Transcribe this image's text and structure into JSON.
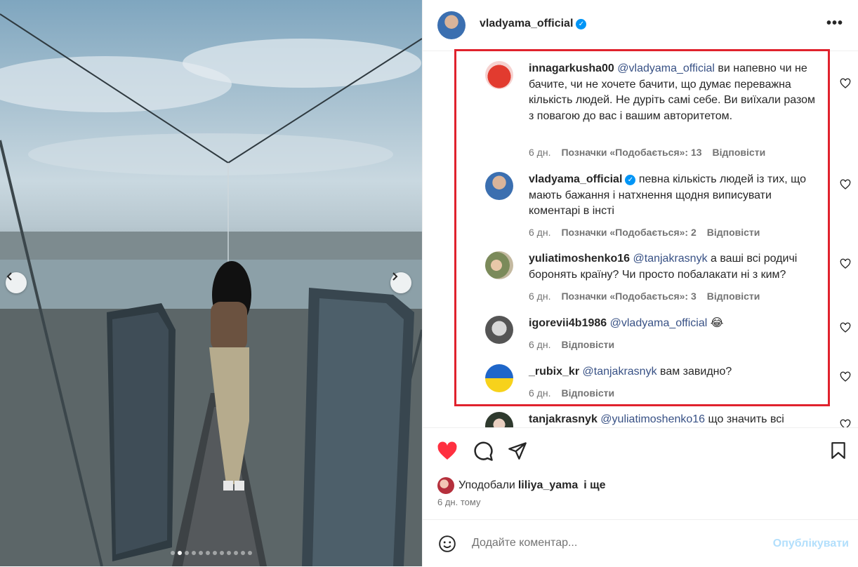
{
  "post": {
    "author": "vladyama_official",
    "more_label": "•••"
  },
  "comments": [
    {
      "user": "innagarkusha00",
      "mention": "@vladyama_official",
      "text": " ви напевно чи не бачите, чи не хочете бачити, що думає переважна кількість людей. Не дуріть самі себе. Ви виїхали разом з повагою до вас і вашим авторитетом.",
      "time": "6 дн.",
      "likes": "Позначки «Подобається»: 13",
      "reply": "Відповісти",
      "verified": false
    },
    {
      "user": "vladyama_official",
      "mention": "",
      "text": " певна кількість людей із тих, що мають бажання і натхнення щодня виписувати коментарі в інсті",
      "time": "6 дн.",
      "likes": "Позначки «Подобається»: 2",
      "reply": "Відповісти",
      "verified": true
    },
    {
      "user": "yuliatimoshenko16",
      "mention": "@tanjakrasnyk",
      "text": " а ваші всі родичі боронять країну? Чи просто побалакати ні з ким?",
      "time": "6 дн.",
      "likes": "Позначки «Подобається»: 3",
      "reply": "Відповісти",
      "verified": false
    },
    {
      "user": "igorevii4b1986",
      "mention": "@vladyama_official",
      "text": " 😂",
      "time": "6 дн.",
      "likes": "",
      "reply": "Відповісти",
      "verified": false
    },
    {
      "user": "_rubix_kr",
      "mention": "@tanjakrasnyk",
      "text": " вам завидно?",
      "time": "6 дн.",
      "likes": "",
      "reply": "Відповісти",
      "verified": false
    },
    {
      "user": "tanjakrasnyk",
      "mention": "@yuliatimoshenko16",
      "text": " що значить всі",
      "time": "",
      "likes": "",
      "reply": "",
      "verified": false
    }
  ],
  "likes_summary": {
    "prefix": "Уподобали",
    "user": "liliya_yama",
    "suffix": "і ще"
  },
  "time_ago": "6 дн. тому",
  "add_comment": {
    "placeholder": "Додайте коментар...",
    "post_label": "Опублікувати"
  },
  "colors": {
    "accent": "#0095f6",
    "like_red": "#ff3040",
    "highlight_box": "#e0222d"
  },
  "icons": [
    "chevron-left-icon",
    "chevron-right-icon",
    "verified-badge-icon",
    "heart-icon",
    "comment-icon",
    "share-icon",
    "bookmark-icon",
    "emoji-icon"
  ]
}
